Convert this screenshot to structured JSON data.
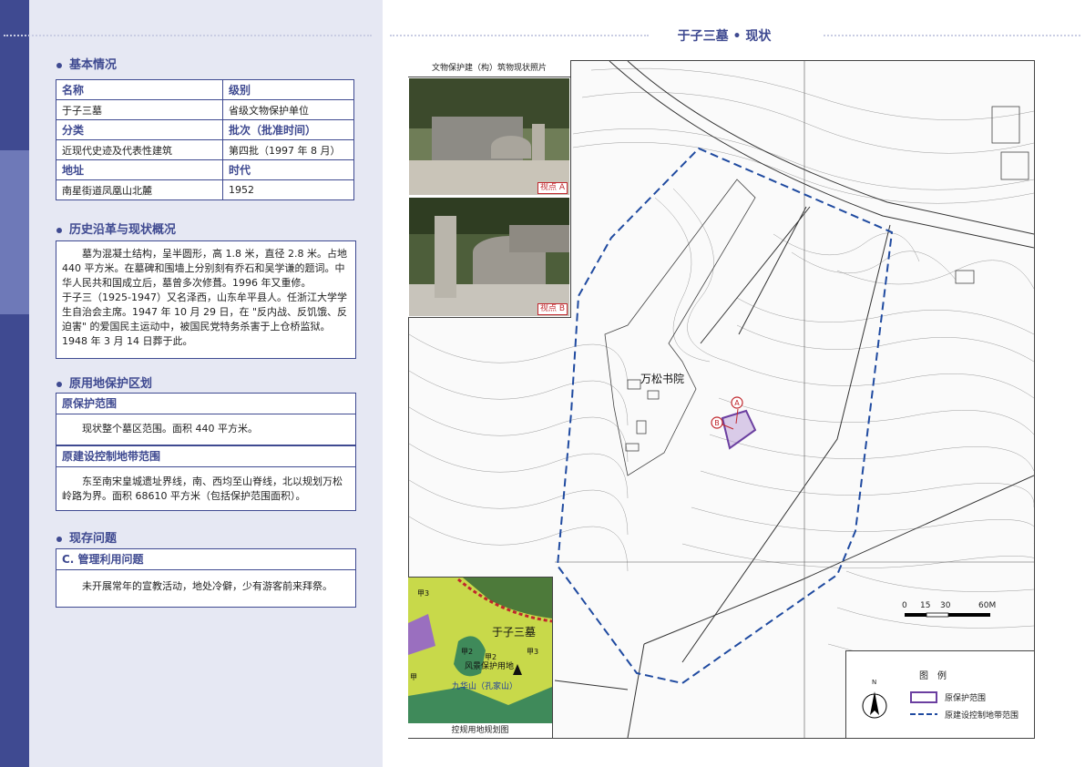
{
  "page": {
    "title": "于子三墓 • 现状"
  },
  "sections": {
    "basic": "基本情况",
    "history": "历史沿革与现状概况",
    "protection": "原用地保护区划",
    "issues": "现存问题"
  },
  "info_table": {
    "rows": [
      [
        "名称",
        "级别"
      ],
      [
        "于子三墓",
        "省级文物保护单位"
      ],
      [
        "分类",
        "批次（批准时间）"
      ],
      [
        "近现代史迹及代表性建筑",
        "第四批（1997 年 8 月）"
      ],
      [
        "地址",
        "时代"
      ],
      [
        "南星街道凤凰山北麓",
        "1952"
      ]
    ]
  },
  "history_text": {
    "p1": "墓为混凝土结构，呈半圆形，高 1.8 米，直径 2.8 米。占地 440 平方米。在墓碑和围墙上分别刻有乔石和吴学谦的题词。中华人民共和国成立后，墓曾多次修葺。1996 年又重修。",
    "p2": "于子三（1925-1947）又名泽西，山东牟平县人。任浙江大学学生自治会主席。1947 年 10 月 29 日，在 \"反内战、反饥饿、反迫害\" 的爱国民主运动中，被国民党特务杀害于上仓桥监狱。1948 年 3 月 14 日葬于此。"
  },
  "protection": {
    "original_title": "原保护范围",
    "original_text": "现状整个墓区范围。面积 440 平方米。",
    "control_title": "原建设控制地带范围",
    "control_text": "东至南宋皇城遗址界线，南、西均至山脊线，北以规划万松岭路为界。面积 68610 平方米（包括保护范围面积）。"
  },
  "issues": {
    "title": "C. 管理利用问题",
    "text": "未开展常年的宣教活动，地处冷僻，少有游客前来拜祭。"
  },
  "map": {
    "photo_title": "文物保护建（构）筑物现状照片",
    "viewpoint_a": "视点 A",
    "viewpoint_b": "视点 B",
    "marker_a": "A",
    "marker_b": "B",
    "place_label": "万松书院",
    "landuse_caption": "控规用地规划图",
    "landuse_tomb": "于子三墓",
    "landuse_scenic": "风景保护用地",
    "landuse_mountain": "九华山（孔家山）",
    "landuse_codes": [
      "甲3",
      "甲2",
      "甲2",
      "甲3",
      "甲"
    ],
    "scale_labels": [
      "0",
      "15",
      "30",
      "60M"
    ],
    "north": "N",
    "legend_title": "图　例",
    "legend_items": [
      "原保护范围",
      "原建设控制地带范围"
    ]
  },
  "colors": {
    "accent": "#3f4a91",
    "strip": "#6e79b8",
    "panel_bg": "#e6e8f3",
    "protect": "#6b3fa0",
    "control": "#1f4aa0",
    "viewpoint": "#c0272d"
  }
}
